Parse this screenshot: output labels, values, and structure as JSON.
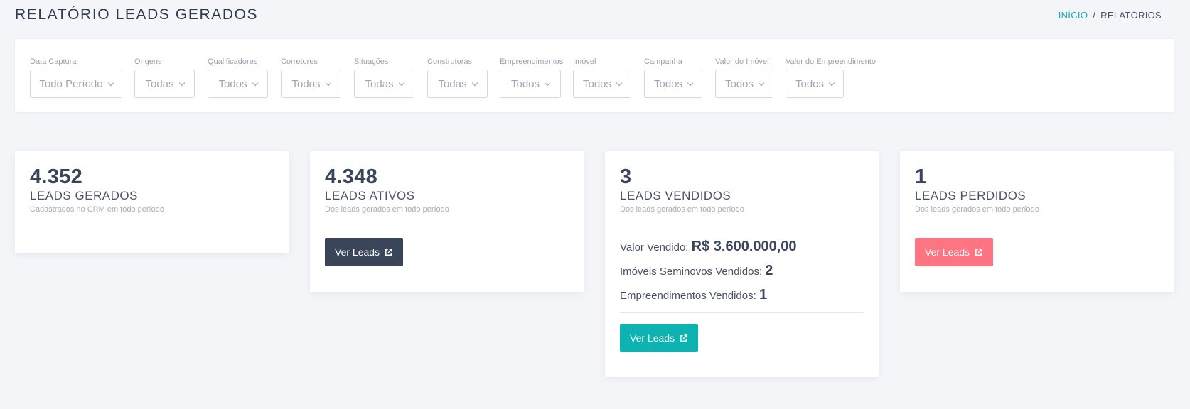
{
  "header": {
    "title": "RELATÓRIO LEADS GERADOS",
    "breadcrumb": {
      "home": "INÍCIO",
      "separator": "/",
      "current": "RELATÓRIOS"
    }
  },
  "filters": [
    {
      "label": "Data Captura",
      "value": "Todo Período"
    },
    {
      "label": "Origens",
      "value": "Todas"
    },
    {
      "label": "Qualificadores",
      "value": "Todos"
    },
    {
      "label": "Corretores",
      "value": "Todos"
    },
    {
      "label": "Situações",
      "value": "Todas"
    },
    {
      "label": "Construtoras",
      "value": "Todas"
    },
    {
      "label": "Empreendimentos",
      "value": "Todos"
    },
    {
      "label": "Imóvel",
      "value": "Todos"
    },
    {
      "label": "Campanha",
      "value": "Todos"
    },
    {
      "label": "Valor do Imóvel",
      "value": "Todos"
    },
    {
      "label": "Valor do Empreendimento",
      "value": "Todos"
    }
  ],
  "cards": {
    "gerados": {
      "number": "4.352",
      "title": "LEADS GERADOS",
      "subtitle": "Cadastrados no CRM em todo período"
    },
    "ativos": {
      "number": "4.348",
      "title": "LEADS ATIVOS",
      "subtitle": "Dos leads gerados em todo período",
      "button": "Ver Leads"
    },
    "vendidos": {
      "number": "3",
      "title": "LEADS VENDIDOS",
      "subtitle": "Dos leads gerados em todo período",
      "valor_label": "Valor Vendido:",
      "valor": "R$ 3.600.000,00",
      "seminovos_label": "Imóveis Seminovos Vendidos:",
      "seminovos": "2",
      "empreendimentos_label": "Empreendimentos Vendidos:",
      "empreendimentos": "1",
      "button": "Ver Leads"
    },
    "perdidos": {
      "number": "1",
      "title": "LEADS PERDIDOS",
      "subtitle": "Dos leads gerados em todo período",
      "button": "Ver Leads"
    }
  },
  "colors": {
    "accent": "#14aeb3",
    "dark_button": "#3b4559",
    "teal_button": "#0db3b0",
    "pink_button": "#fd7483"
  },
  "icons": {
    "chevron": "chevron-down-icon",
    "external_link": "external-link-icon"
  }
}
